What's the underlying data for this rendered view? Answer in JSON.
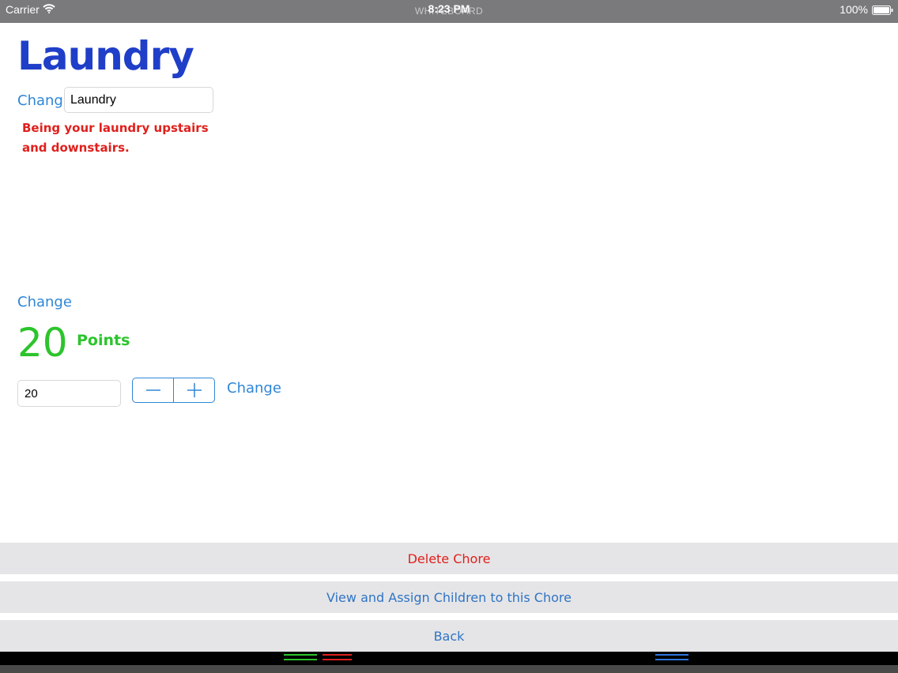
{
  "status_bar": {
    "carrier": "Carrier",
    "app_name": "WHITEBOARD",
    "time": "8:23 PM",
    "battery": "100%"
  },
  "chore": {
    "title": "Laundry",
    "name_change_label": "Change",
    "name_value": "Laundry",
    "description": "Being your laundry upstairs and downstairs.",
    "description_change_label": "Change",
    "points_value": "20",
    "points_label": "Points",
    "points_field_value": "20",
    "points_change_label": "Change"
  },
  "stepper": {
    "decrement_icon": "minus-icon",
    "increment_icon": "plus-icon"
  },
  "actions": {
    "delete_label": "Delete Chore",
    "assign_label": "View and Assign Children to this Chore",
    "back_label": "Back"
  },
  "colors": {
    "title_blue": "#1f3fc9",
    "link_blue": "#2f86d6",
    "description_red": "#e0201c",
    "points_green": "#2cc42c",
    "button_gray": "#e5e5e7",
    "status_bar_gray": "#7a7a7c"
  }
}
